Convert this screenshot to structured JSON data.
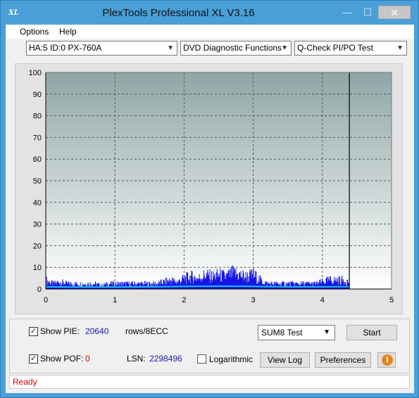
{
  "window": {
    "title": "PlexTools Professional XL V3.16",
    "icon_text": "XL",
    "min_glyph": "—",
    "max_glyph": "☐",
    "close_glyph": "✕"
  },
  "menu": {
    "options": "Options",
    "help": "Help"
  },
  "selectors": {
    "drive": "HA:5 ID:0  PX-760A",
    "function": "DVD Diagnostic Functions",
    "test": "Q-Check PI/PO Test"
  },
  "controls": {
    "show_pie_label": "Show PIE:",
    "show_pie_checked": true,
    "pie_value": "20640",
    "rows_label": "rows/8ECC",
    "show_poe_label": "Show POF:",
    "show_poe_checked": true,
    "poe_value": "0",
    "lsn_label": "LSN:",
    "lsn_value": "2298496",
    "logarithmic_label": "Logarithmic",
    "logarithmic_checked": false,
    "test_select": "SUM8 Test",
    "start_button": "Start",
    "view_log_button": "View Log",
    "preferences_button": "Preferences",
    "check_glyph": "✓",
    "info_glyph": "i"
  },
  "status": {
    "text": "Ready"
  },
  "colors": {
    "pie_bars": "#1010e8",
    "pie_avg_line": "#19c3f0",
    "status_text": "#d00000",
    "value_text": "#1a1aa0"
  },
  "chart_data": {
    "type": "bar",
    "x_ticks": [
      "0",
      "1",
      "2",
      "3",
      "4",
      "5"
    ],
    "y_ticks": [
      "0",
      "10",
      "20",
      "30",
      "40",
      "50",
      "60",
      "70",
      "80",
      "90",
      "100"
    ],
    "xlim": [
      0,
      5
    ],
    "ylim": [
      0,
      100
    ],
    "grid": true,
    "end_marker_x": 4.39,
    "series": [
      {
        "x": [
          0.0,
          0.1,
          0.2,
          0.3,
          0.4,
          0.5,
          0.6,
          0.7,
          0.8,
          0.9,
          1.0,
          1.1,
          1.2,
          1.3,
          1.4,
          1.5,
          1.6,
          1.7,
          1.8,
          1.9,
          2.0,
          2.1,
          2.2,
          2.3,
          2.4,
          2.5,
          2.6,
          2.7,
          2.8,
          2.9,
          3.0,
          3.1,
          3.2,
          3.3,
          3.4,
          3.5,
          3.6,
          3.7,
          3.8,
          3.9,
          4.0,
          4.1,
          4.2,
          4.3,
          4.39
        ],
        "y": [
          5,
          3,
          4,
          3,
          3,
          3,
          3,
          3,
          2,
          3,
          3,
          3,
          3,
          3,
          3,
          3,
          3,
          4,
          5,
          4,
          6,
          7,
          6,
          8,
          7,
          8,
          7,
          9,
          8,
          7,
          8,
          5,
          3,
          3,
          3,
          3,
          3,
          3,
          3,
          3,
          4,
          5,
          5,
          5,
          4
        ]
      },
      {
        "x": [
          0.0,
          0.5,
          1.0,
          1.5,
          2.0,
          2.5,
          3.0,
          3.5,
          4.0,
          4.39
        ],
        "y": [
          1.0,
          0.9,
          0.9,
          1.0,
          1.2,
          1.3,
          1.2,
          1.0,
          1.0,
          1.1
        ]
      }
    ]
  }
}
